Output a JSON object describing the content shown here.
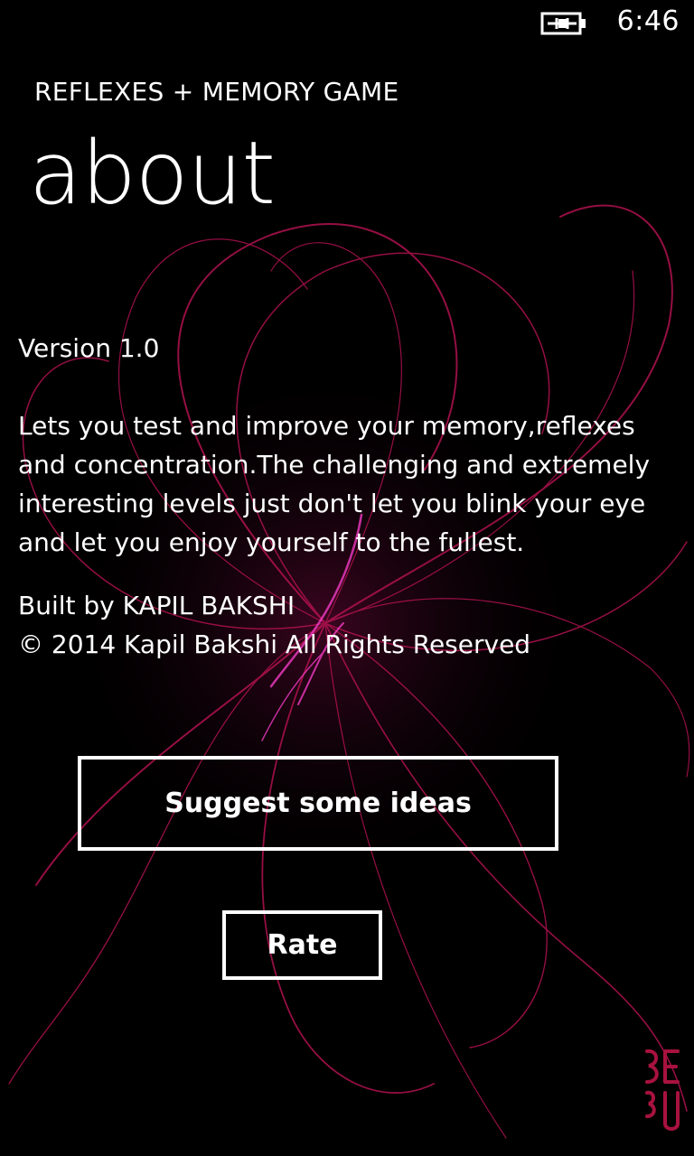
{
  "status_bar": {
    "time": "6:46",
    "battery_icon": "battery-charging-icon"
  },
  "header": {
    "app_title": "REFLEXES + MEMORY GAME",
    "page_title": "about"
  },
  "content": {
    "version": "Version 1.0",
    "description": "Lets you test and improve your memory,reflexes and concentration.The challenging and extremely interesting levels just don't let you blink your eye and let you enjoy yourself to the fullest.",
    "built_by": "Built by KAPIL BAKSHI",
    "copyright": "© 2014 Kapil Bakshi All Rights Reserved"
  },
  "buttons": {
    "suggest_label": "Suggest some ideas",
    "rate_label": "Rate"
  },
  "colors": {
    "background": "#000000",
    "accent_swirl": "#c2185b",
    "highlight": "#ff3fd0",
    "text": "#ffffff"
  }
}
